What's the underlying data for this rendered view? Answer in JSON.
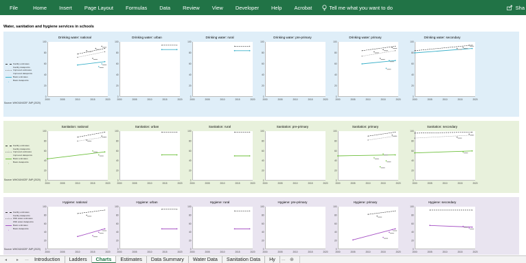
{
  "ribbon": {
    "tabs": [
      "File",
      "Home",
      "Insert",
      "Page Layout",
      "Formulas",
      "Data",
      "Review",
      "View",
      "Developer",
      "Help",
      "Acrobat"
    ],
    "tell_me": "Tell me what you want to do",
    "share": "Sha"
  },
  "sheet": {
    "title": "Water, sanitation and hygiene services in schools",
    "source_water": "Source: WHO/UNICEF JMP (2020)",
    "source_sanitation": "Source: WHO/UNICEF JMP (2020)",
    "source_hygiene": "Source: WHO/UNICEF JMP (2020)"
  },
  "legends": {
    "water": [
      "Facility estimates",
      "Facility datapoints",
      "Improved estimates",
      "Improved datapoints",
      "Basic estimates",
      "Basic datapoints"
    ],
    "sanitation": [
      "Facility estimates",
      "Facility datapoints",
      "Improved estimates",
      "Improved datapoints",
      "Basic estimates",
      "Basic datapoints"
    ],
    "hygiene": [
      "Facility estimates",
      "Facility datapoints",
      "With water estimates",
      "With water datapoints",
      "Basic estimates",
      "Basic datapoints"
    ]
  },
  "colors": {
    "ribbon": "#217346",
    "water_band": "#dfeef8",
    "sanitation_band": "#e8f1dc",
    "hygiene_band": "#e9e4f0",
    "water_basic": "#3ab0c9",
    "sanitation_basic": "#6cbf3a",
    "hygiene_basic": "#a54fc4",
    "facility": "#333333"
  },
  "sheet_tabs": [
    "Introduction",
    "Ladders",
    "Charts",
    "Estimates",
    "Data Summary",
    "Water Data",
    "Sanitation Data",
    "Hy"
  ],
  "active_sheet": "Charts",
  "chart_data": [
    {
      "type": "line",
      "title": "Drinking water: national",
      "ylim": [
        0,
        100
      ],
      "x_ticks": [
        "2000",
        "2005",
        "2010",
        "2015",
        "2020"
      ],
      "series": [
        {
          "name": "Facility estimates",
          "x": [
            2010,
            2019
          ],
          "values": [
            78,
            88
          ]
        },
        {
          "name": "Improved estimates",
          "x": [
            2010,
            2019
          ],
          "values": [
            72,
            82
          ]
        },
        {
          "name": "Basic estimates",
          "x": [
            2010,
            2019
          ],
          "values": [
            58,
            64
          ]
        }
      ],
      "datapoints": [
        [
          2013,
          84
        ],
        [
          2015,
          70
        ],
        [
          2016,
          88
        ],
        [
          2017,
          55
        ],
        [
          2018,
          60
        ],
        [
          2018,
          92
        ]
      ]
    },
    {
      "type": "line",
      "title": "Drinking water: urban",
      "ylim": [
        0,
        100
      ],
      "x_ticks": [
        "2000",
        "2005",
        "2010",
        "2015",
        "2020"
      ],
      "series": [
        {
          "name": "Facility estimates",
          "x": [
            2014,
            2019
          ],
          "values": [
            94,
            94
          ]
        },
        {
          "name": "Basic estimates",
          "x": [
            2014,
            2019
          ],
          "values": [
            86,
            86
          ]
        }
      ],
      "datapoints": []
    },
    {
      "type": "line",
      "title": "Drinking water: rural",
      "ylim": [
        0,
        100
      ],
      "x_ticks": [
        "2000",
        "2005",
        "2010",
        "2015",
        "2020"
      ],
      "series": [
        {
          "name": "Facility estimates",
          "x": [
            2014,
            2019
          ],
          "values": [
            92,
            92
          ]
        },
        {
          "name": "Basic estimates",
          "x": [
            2014,
            2019
          ],
          "values": [
            84,
            84
          ]
        }
      ],
      "datapoints": []
    },
    {
      "type": "line",
      "title": "Drinking water: pre-primary",
      "ylim": [
        0,
        100
      ],
      "x_ticks": [
        "2000",
        "2005",
        "2010",
        "2015",
        "2020"
      ],
      "series": [],
      "datapoints": []
    },
    {
      "type": "line",
      "title": "Drinking water: primary",
      "ylim": [
        0,
        100
      ],
      "x_ticks": [
        "2000",
        "2005",
        "2010",
        "2015",
        "2020"
      ],
      "series": [
        {
          "name": "Facility estimates",
          "x": [
            2008,
            2019
          ],
          "values": [
            84,
            92
          ]
        },
        {
          "name": "Improved estimates",
          "x": [
            2008,
            2019
          ],
          "values": [
            74,
            84
          ]
        },
        {
          "name": "Basic estimates",
          "x": [
            2008,
            2019
          ],
          "values": [
            60,
            66
          ]
        }
      ],
      "datapoints": [
        [
          2012,
          82
        ],
        [
          2014,
          70
        ],
        [
          2015,
          86
        ],
        [
          2016,
          52
        ],
        [
          2017,
          66
        ],
        [
          2018,
          90
        ]
      ]
    },
    {
      "type": "line",
      "title": "Drinking water: secondary",
      "ylim": [
        0,
        100
      ],
      "x_ticks": [
        "2000",
        "2005",
        "2010",
        "2015",
        "2020"
      ],
      "series": [
        {
          "name": "Facility estimates",
          "x": [
            2000,
            2019
          ],
          "values": [
            84,
            94
          ]
        },
        {
          "name": "Basic estimates",
          "x": [
            2000,
            2019
          ],
          "values": [
            80,
            88
          ]
        }
      ],
      "datapoints": [
        [
          2014,
          88
        ],
        [
          2016,
          90
        ],
        [
          2018,
          94
        ]
      ]
    },
    {
      "type": "line",
      "title": "Sanitation: national",
      "ylim": [
        0,
        100
      ],
      "x_ticks": [
        "2000",
        "2005",
        "2010",
        "2015",
        "2020"
      ],
      "series": [
        {
          "name": "Facility estimates",
          "x": [
            2010,
            2019
          ],
          "values": [
            88,
            98
          ]
        },
        {
          "name": "Improved estimates",
          "x": [
            2010,
            2019
          ],
          "values": [
            80,
            88
          ]
        },
        {
          "name": "Basic estimates",
          "x": [
            2000,
            2019
          ],
          "values": [
            44,
            58
          ]
        }
      ],
      "datapoints": [
        [
          2013,
          82
        ],
        [
          2015,
          60
        ],
        [
          2017,
          52
        ],
        [
          2018,
          90
        ]
      ]
    },
    {
      "type": "line",
      "title": "Sanitation: urban",
      "ylim": [
        0,
        100
      ],
      "x_ticks": [
        "2000",
        "2005",
        "2010",
        "2015",
        "2020"
      ],
      "series": [
        {
          "name": "Facility estimates",
          "x": [
            2014,
            2019
          ],
          "values": [
            98,
            98
          ]
        },
        {
          "name": "Basic estimates",
          "x": [
            2014,
            2019
          ],
          "values": [
            52,
            52
          ]
        }
      ],
      "datapoints": []
    },
    {
      "type": "line",
      "title": "Sanitation: rural",
      "ylim": [
        0,
        100
      ],
      "x_ticks": [
        "2000",
        "2005",
        "2010",
        "2015",
        "2020"
      ],
      "series": [
        {
          "name": "Facility estimates",
          "x": [
            2014,
            2019
          ],
          "values": [
            98,
            98
          ]
        },
        {
          "name": "Basic estimates",
          "x": [
            2014,
            2019
          ],
          "values": [
            50,
            50
          ]
        }
      ],
      "datapoints": []
    },
    {
      "type": "line",
      "title": "Sanitation: pre-primary",
      "ylim": [
        0,
        100
      ],
      "x_ticks": [
        "2000",
        "2005",
        "2010",
        "2015",
        "2020"
      ],
      "series": [],
      "datapoints": []
    },
    {
      "type": "line",
      "title": "Sanitation: primary",
      "ylim": [
        0,
        100
      ],
      "x_ticks": [
        "2000",
        "2005",
        "2010",
        "2015",
        "2020"
      ],
      "series": [
        {
          "name": "Facility estimates",
          "x": [
            2010,
            2019
          ],
          "values": [
            90,
            98
          ]
        },
        {
          "name": "Improved estimates",
          "x": [
            2010,
            2019
          ],
          "values": [
            82,
            90
          ]
        },
        {
          "name": "Basic estimates",
          "x": [
            2000,
            2019
          ],
          "values": [
            50,
            52
          ]
        }
      ],
      "datapoints": [
        [
          2012,
          46
        ],
        [
          2014,
          28
        ],
        [
          2015,
          54
        ],
        [
          2016,
          40
        ],
        [
          2018,
          92
        ]
      ]
    },
    {
      "type": "line",
      "title": "Sanitation: secondary",
      "ylim": [
        0,
        100
      ],
      "x_ticks": [
        "2000",
        "2005",
        "2010",
        "2015",
        "2020"
      ],
      "series": [
        {
          "name": "Facility estimates",
          "x": [
            2000,
            2019
          ],
          "values": [
            96,
            98
          ]
        },
        {
          "name": "Improved estimates",
          "x": [
            2000,
            2019
          ],
          "values": [
            86,
            92
          ]
        },
        {
          "name": "Basic estimates",
          "x": [
            2000,
            2019
          ],
          "values": [
            56,
            60
          ]
        }
      ],
      "datapoints": [
        [
          2014,
          88
        ],
        [
          2016,
          58
        ],
        [
          2018,
          94
        ]
      ]
    },
    {
      "type": "line",
      "title": "Hygiene: national",
      "ylim": [
        0,
        100
      ],
      "x_ticks": [
        "2000",
        "2005",
        "2010",
        "2015",
        "2020"
      ],
      "series": [
        {
          "name": "Facility estimates",
          "x": [
            2010,
            2019
          ],
          "values": [
            84,
            92
          ]
        },
        {
          "name": "Basic estimates",
          "x": [
            2010,
            2019
          ],
          "values": [
            30,
            48
          ]
        }
      ],
      "datapoints": [
        [
          2013,
          80
        ],
        [
          2015,
          32
        ],
        [
          2017,
          40
        ],
        [
          2018,
          46
        ]
      ]
    },
    {
      "type": "line",
      "title": "Hygiene: urban",
      "ylim": [
        0,
        100
      ],
      "x_ticks": [
        "2000",
        "2005",
        "2010",
        "2015",
        "2020"
      ],
      "series": [
        {
          "name": "Facility estimates",
          "x": [
            2014,
            2019
          ],
          "values": [
            94,
            94
          ]
        },
        {
          "name": "Basic estimates",
          "x": [
            2014,
            2019
          ],
          "values": [
            48,
            48
          ]
        }
      ],
      "datapoints": []
    },
    {
      "type": "line",
      "title": "Hygiene: rural",
      "ylim": [
        0,
        100
      ],
      "x_ticks": [
        "2000",
        "2005",
        "2010",
        "2015",
        "2020"
      ],
      "series": [
        {
          "name": "Facility estimates",
          "x": [
            2014,
            2019
          ],
          "values": [
            90,
            90
          ]
        },
        {
          "name": "Basic estimates",
          "x": [
            2014,
            2019
          ],
          "values": [
            48,
            48
          ]
        }
      ],
      "datapoints": []
    },
    {
      "type": "line",
      "title": "Hygiene: pre-primary",
      "ylim": [
        0,
        100
      ],
      "x_ticks": [
        "2000",
        "2005",
        "2010",
        "2015",
        "2020"
      ],
      "series": [],
      "datapoints": []
    },
    {
      "type": "line",
      "title": "Hygiene: primary",
      "ylim": [
        0,
        100
      ],
      "x_ticks": [
        "2000",
        "2005",
        "2010",
        "2015",
        "2020"
      ],
      "series": [
        {
          "name": "Facility estimates",
          "x": [
            2010,
            2019
          ],
          "values": [
            82,
            90
          ]
        },
        {
          "name": "Basic estimates",
          "x": [
            2005,
            2019
          ],
          "values": [
            22,
            48
          ]
        }
      ],
      "datapoints": [
        [
          2013,
          78
        ],
        [
          2015,
          28
        ],
        [
          2017,
          40
        ],
        [
          2018,
          46
        ]
      ]
    },
    {
      "type": "line",
      "title": "Hygiene: secondary",
      "ylim": [
        0,
        100
      ],
      "x_ticks": [
        "2000",
        "2005",
        "2010",
        "2015",
        "2020"
      ],
      "series": [
        {
          "name": "Facility estimates",
          "x": [
            2005,
            2019
          ],
          "values": [
            92,
            92
          ]
        },
        {
          "name": "Basic estimates",
          "x": [
            2005,
            2019
          ],
          "values": [
            56,
            52
          ]
        }
      ],
      "datapoints": [
        [
          2016,
          54
        ],
        [
          2018,
          50
        ]
      ]
    }
  ]
}
